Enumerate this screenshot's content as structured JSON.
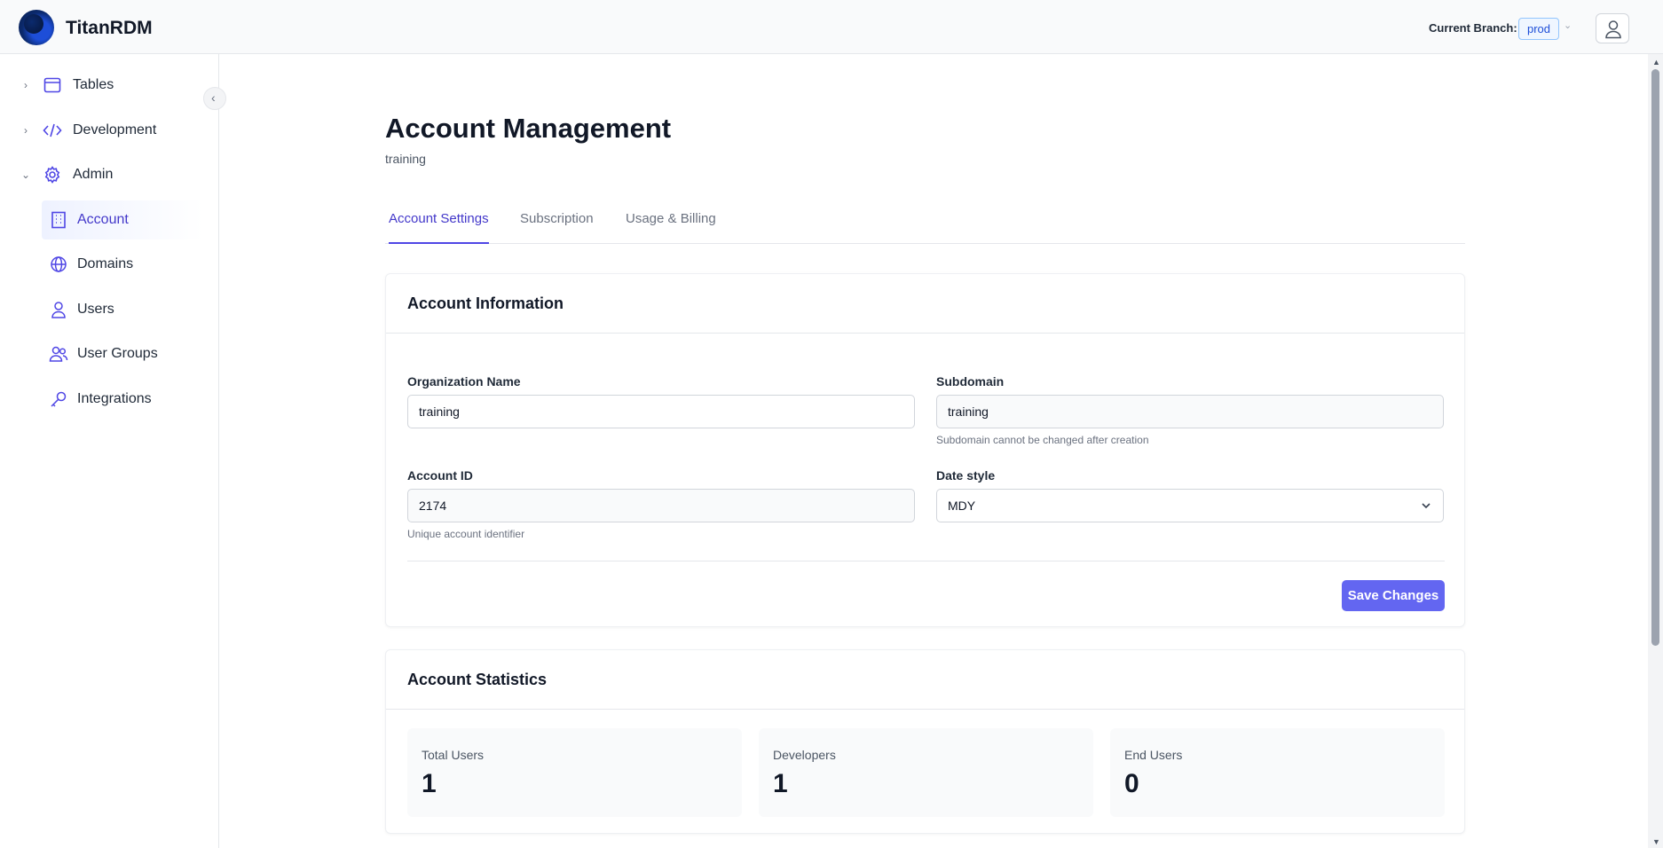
{
  "app": {
    "brand": "TitanRDM"
  },
  "header": {
    "branch_label": "Current Branch:",
    "branch_value": "prod"
  },
  "sidebar": {
    "groups": [
      {
        "label": "Tables",
        "icon": "table-icon",
        "expanded": false
      },
      {
        "label": "Development",
        "icon": "code-icon",
        "expanded": false
      },
      {
        "label": "Admin",
        "icon": "gear-icon",
        "expanded": true
      }
    ],
    "admin_items": [
      {
        "label": "Account",
        "icon": "building-icon",
        "active": true
      },
      {
        "label": "Domains",
        "icon": "globe-icon",
        "active": false
      },
      {
        "label": "Users",
        "icon": "user-icon",
        "active": false
      },
      {
        "label": "User Groups",
        "icon": "users-icon",
        "active": false
      },
      {
        "label": "Integrations",
        "icon": "key-icon",
        "active": false
      }
    ]
  },
  "page": {
    "title": "Account Management",
    "subtitle": "training"
  },
  "tabs": [
    {
      "label": "Account Settings",
      "active": true
    },
    {
      "label": "Subscription",
      "active": false
    },
    {
      "label": "Usage & Billing",
      "active": false
    }
  ],
  "account_info": {
    "title": "Account Information",
    "org_name": {
      "label": "Organization Name",
      "value": "training"
    },
    "subdomain": {
      "label": "Subdomain",
      "value": "training",
      "help": "Subdomain cannot be changed after creation"
    },
    "account_id": {
      "label": "Account ID",
      "value": "2174",
      "help": "Unique account identifier"
    },
    "date_style": {
      "label": "Date style",
      "value": "MDY"
    },
    "save_label": "Save Changes"
  },
  "account_stats": {
    "title": "Account Statistics",
    "items": [
      {
        "label": "Total Users",
        "value": "1"
      },
      {
        "label": "Developers",
        "value": "1"
      },
      {
        "label": "End Users",
        "value": "0"
      }
    ]
  },
  "colors": {
    "accent": "#4f46e5",
    "button": "#6366f1",
    "icon": "#4f46e5"
  }
}
